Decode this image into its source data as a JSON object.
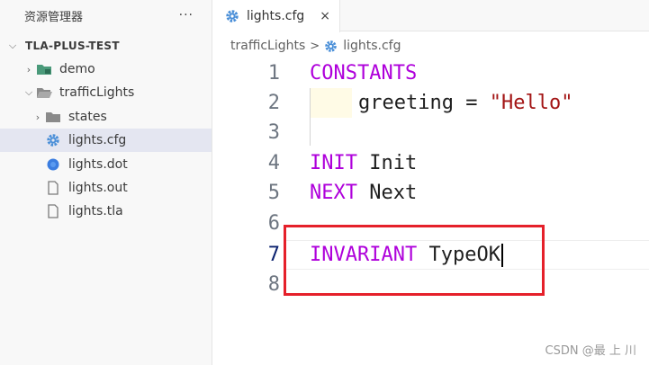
{
  "sidebar": {
    "title": "资源管理器",
    "more": "···",
    "root": {
      "label": "TLA-PLUS-TEST"
    },
    "items": [
      {
        "label": "demo"
      },
      {
        "label": "trafficLights"
      },
      {
        "label": "states"
      },
      {
        "label": "lights.cfg"
      },
      {
        "label": "lights.dot"
      },
      {
        "label": "lights.out"
      },
      {
        "label": "lights.tla"
      }
    ]
  },
  "tab": {
    "label": "lights.cfg",
    "close": "×"
  },
  "breadcrumb": {
    "folder": "trafficLights",
    "separator": ">",
    "file": "lights.cfg"
  },
  "editor": {
    "line_numbers": [
      "1",
      "2",
      "3",
      "4",
      "5",
      "6",
      "7",
      "8"
    ],
    "lines": {
      "l1_kw": "CONSTANTS",
      "l2_name": "greeting",
      "l2_op": " = ",
      "l2_str": "\"Hello\"",
      "l4_kw": "INIT",
      "l4_rest": " Init",
      "l5_kw": "NEXT",
      "l5_rest": " Next",
      "l7_kw": "INVARIANT",
      "l7_rest": " TypeOK"
    }
  },
  "watermark": "CSDN @最 上 川",
  "colors": {
    "keyword": "#af00db",
    "string": "#a31515",
    "folder_icon": "#8a8a8a",
    "gear_icon": "#4a8fd8",
    "annotation": "#e5202a"
  }
}
